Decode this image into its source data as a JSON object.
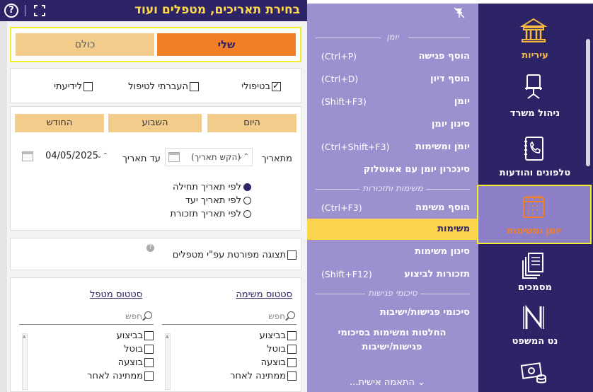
{
  "panel": {
    "title": "בחירת תאריכים, מטפלים ועוד",
    "help_glyph": "?",
    "toggle": {
      "mine": "שלי",
      "all": "כולם"
    },
    "types": {
      "mine_label": "בטיפולי",
      "transferred_label": "העברתי לטיפול",
      "fyi_label": "לידיעתי"
    },
    "periods": {
      "today": "היום",
      "week": "השבוע",
      "month": "החודש"
    },
    "from_label": "מתאריך",
    "from_placeholder": "(הקש תאריך)",
    "to_label": "עד תאריך",
    "to_value": "04/05/2025",
    "spinner_glyph": "⌃⌄",
    "radios": [
      "לפי תאריך תחילה",
      "לפי תאריך יעד",
      "לפי תאריך תזכורת"
    ],
    "detail_label": "תצוגה מפורטת עפ\"י מטפלים",
    "status": {
      "task_title": "סטטוס משימה",
      "handler_title": "סטטוס מטפל",
      "search_placeholder": "חפש",
      "task_items": [
        "בביצוע",
        "בוטל",
        "בוצעה",
        "ממתינה לאחר"
      ],
      "handler_items": [
        "בביצוע",
        "בוטל",
        "בוצעה",
        "ממתינה לאחר"
      ]
    }
  },
  "menu": {
    "section_diary": "יומן",
    "section_tasks": "משימות ותזכורות",
    "section_meetings": "סיכומי פגישות",
    "items_diary": [
      {
        "label": "הוסף פגישה",
        "shortcut": "(Ctrl+P)"
      },
      {
        "label": "הוסף דיון",
        "shortcut": "(Ctrl+D)"
      },
      {
        "label": "יומן",
        "shortcut": "(Shift+F3)"
      },
      {
        "label": "סינון יומן",
        "shortcut": ""
      },
      {
        "label": "יומן ומשימות",
        "shortcut": "(Ctrl+Shift+F3)"
      },
      {
        "label": "סינכרון יומן עם אאוטלוק",
        "shortcut": ""
      }
    ],
    "items_tasks": [
      {
        "label": "הוסף משימה",
        "shortcut": "(Ctrl+F3)"
      },
      {
        "label": "משימות",
        "shortcut": ""
      },
      {
        "label": "סינון משימות",
        "shortcut": ""
      },
      {
        "label": "תזכורות לביצוע",
        "shortcut": "(Shift+F12)"
      }
    ],
    "items_meetings": [
      {
        "label": "סיכומי פגישות/ישיבות",
        "shortcut": ""
      },
      {
        "label": "החלטות ומשימות בסיכומי פגישות/ישיבות",
        "shortcut": ""
      }
    ],
    "personalize": "⌄ התאמה אישית..."
  },
  "sidebar": {
    "items": [
      {
        "label": "עיריות",
        "icon": "building-icon"
      },
      {
        "label": "ניהול משרד",
        "icon": "office-chair-icon"
      },
      {
        "label": "טלפונים והודעות",
        "icon": "phone-book-icon"
      },
      {
        "label": "יומן ומשימות",
        "icon": "calendar-tasks-icon"
      },
      {
        "label": "מסמכים",
        "icon": "documents-icon"
      },
      {
        "label": "נט המשפט",
        "icon": "net-hamishpat-icon"
      },
      {
        "label": "",
        "icon": "money-icon"
      }
    ]
  },
  "colors": {
    "header": "#2c2466",
    "accent": "#f27f24",
    "menu_bg": "#9d90cf",
    "highlight": "#fcd34d",
    "focus": "#f2ee2a"
  }
}
